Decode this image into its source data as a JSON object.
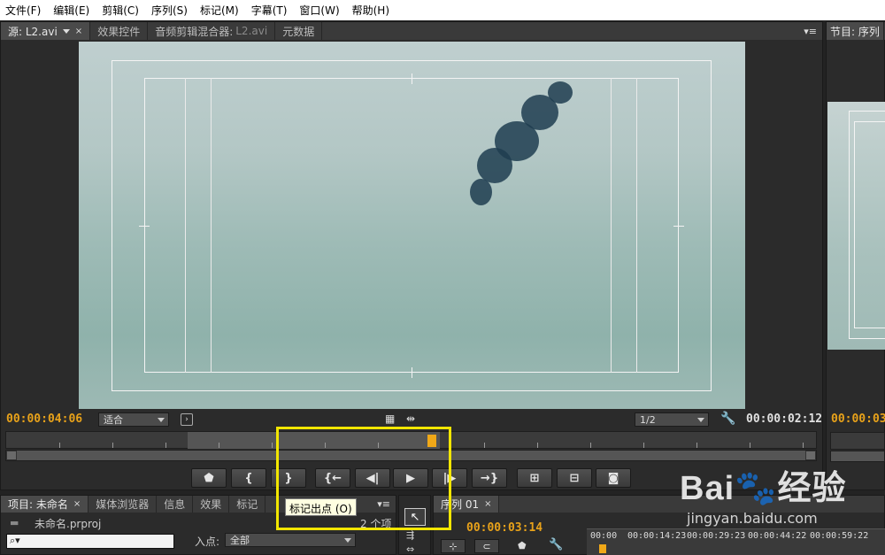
{
  "menu": [
    "文件(F)",
    "编辑(E)",
    "剪辑(C)",
    "序列(S)",
    "标记(M)",
    "字幕(T)",
    "窗口(W)",
    "帮助(H)"
  ],
  "source_tabs": {
    "source_label": "源: L2.avi",
    "effect_controls": "效果控件",
    "audio_mixer": "音频剪辑混合器:",
    "audio_mixer_clip": "L2.avi",
    "metadata": "元数据"
  },
  "program_tab": "节目: 序列",
  "source_monitor": {
    "current_time": "00:00:04:06",
    "fit_select": "适合",
    "resolution_select": "1/2",
    "duration": "00:00:02:12"
  },
  "program_monitor": {
    "current_time": "00:00:03:"
  },
  "transport": {
    "marker_icon": "add-marker-icon",
    "mark_in": "{",
    "mark_out": "}",
    "go_to_in": "{←",
    "step_back": "◀|",
    "play": "▶",
    "step_forward": "|▶",
    "go_to_out": "→}"
  },
  "tooltip": "标记出点 (O)",
  "project_panel": {
    "tabs": [
      "项目: 未命名",
      "媒体浏览器",
      "信息",
      "效果",
      "标记"
    ],
    "project_file": "未命名.prproj",
    "item_count": "2 个项",
    "in_point_label": "入点:",
    "in_point_value": "全部",
    "search_placeholder": ""
  },
  "sequence_panel": {
    "tab": "序列 01",
    "current_time": "00:00:03:14",
    "ruler": [
      "00:00",
      "00:00:14:23",
      "00:00:29:23",
      "00:00:44:22",
      "00:00:59:22"
    ]
  },
  "watermark": {
    "brand": "Bai",
    "brand2": "经验",
    "url": "jingyan.baidu.com"
  },
  "colors": {
    "timecode": "#e8a21a",
    "highlight": "#f2e600",
    "tooltip_bg": "#ffffe1"
  }
}
